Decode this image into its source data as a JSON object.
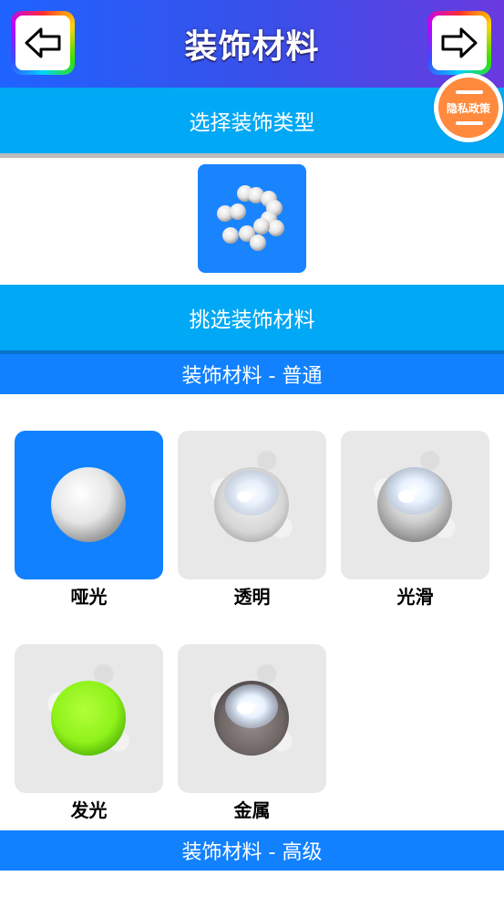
{
  "header": {
    "title": "装饰材料",
    "back_icon": "arrow-left-icon",
    "forward_icon": "arrow-right-icon"
  },
  "privacy": {
    "label": "隐私政策"
  },
  "select_type": {
    "label": "选择装饰类型",
    "tile_icon": "pearl-cluster-icon"
  },
  "pick_material": {
    "label": "挑选装饰材料"
  },
  "sections": [
    {
      "title": "装饰材料 - 普通",
      "items": [
        {
          "label": "哑光",
          "icon": "matte-sphere-icon",
          "selected": true
        },
        {
          "label": "透明",
          "icon": "transparent-sphere-icon",
          "selected": false
        },
        {
          "label": "光滑",
          "icon": "glossy-sphere-icon",
          "selected": false
        },
        {
          "label": "发光",
          "icon": "glowing-sphere-icon",
          "selected": false
        },
        {
          "label": "金属",
          "icon": "metal-sphere-icon",
          "selected": false
        }
      ]
    },
    {
      "title": "装饰材料 - 高级"
    }
  ],
  "colors": {
    "header_start": "#1f63ff",
    "header_end": "#6a3ae0",
    "bar": "#00a8f5",
    "section": "#1181ff",
    "selected_tile": "#1181ff",
    "privacy_button": "#ff8a3d",
    "glow_sphere": "#8ff21a"
  }
}
